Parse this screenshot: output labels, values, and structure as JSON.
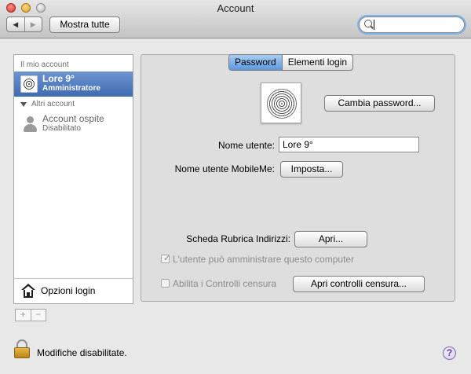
{
  "window": {
    "title": "Account",
    "nav_back": "◀",
    "nav_forward": "▶",
    "show_all_label": "Mostra tutte",
    "search": {
      "value": "",
      "placeholder": ""
    }
  },
  "sidebar": {
    "my_account_header": "Il mio account",
    "my_account": {
      "name": "Lore 9°",
      "role": "Amministratore"
    },
    "other_accounts_header": "Altri account",
    "guest": {
      "name": "Account ospite",
      "status": "Disabilitato"
    },
    "login_options_label": "Opzioni login",
    "add_label": "+",
    "remove_label": "−"
  },
  "main": {
    "tabs": [
      {
        "label": "Password",
        "active": true
      },
      {
        "label": "Elementi login",
        "active": false
      }
    ],
    "change_password_label": "Cambia password...",
    "username_label": "Nome utente:",
    "username_value": "Lore 9°",
    "mobileme_label": "Nome utente MobileMe:",
    "mobileme_button": "Imposta...",
    "address_book_label": "Scheda Rubrica Indirizzi:",
    "address_book_button": "Apri...",
    "admin_checkbox_label": "L'utente può amministrare questo computer",
    "admin_checked": true,
    "parental_checkbox_label": "Abilita i Controlli censura",
    "parental_checked": false,
    "parental_button": "Apri controlli censura..."
  },
  "footer": {
    "lock_text": "Modifiche disabilitate.",
    "help_label": "?"
  },
  "colors": {
    "selection": "#3f6bb2",
    "tab_active": "#5b98de",
    "search_focus": "#7fb2ea"
  }
}
